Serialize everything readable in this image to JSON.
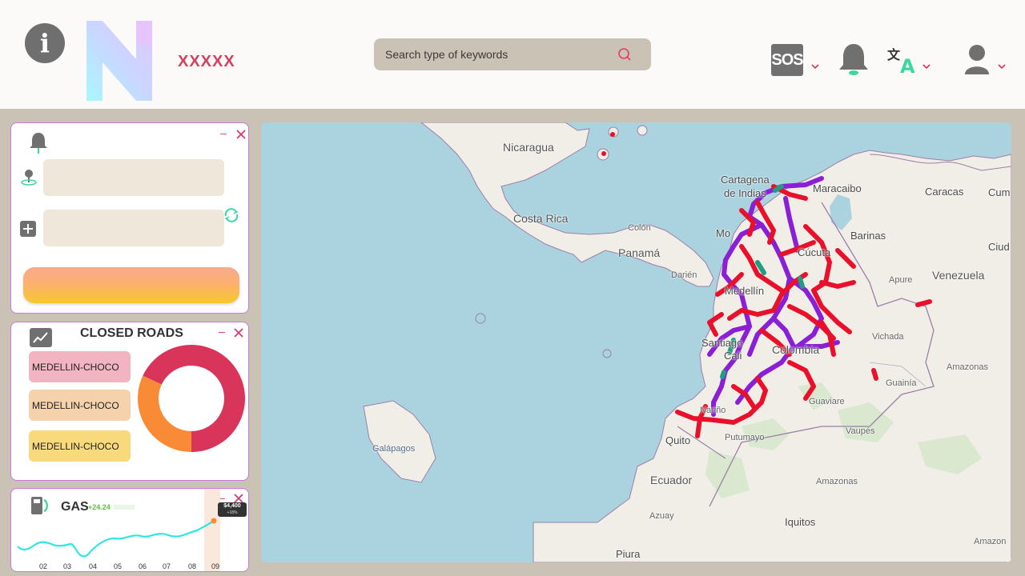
{
  "header": {
    "brand": "XXXXX",
    "search": {
      "placeholder": "Search type of keywords",
      "value": ""
    },
    "sos_label": "SOS",
    "info_label": "i"
  },
  "colors": {
    "accent": "#d6405f",
    "panel_border": "#c77ad8",
    "road_closed": "#e8102a",
    "road_purple": "#8a1fd6",
    "road_teal": "#1f9e82"
  },
  "closed_roads": {
    "title": "CLOSED ROADS",
    "items": [
      {
        "label": "MEDELLIN-CHOCO",
        "color": "#f2b4c0"
      },
      {
        "label": "MEDELLIN-CHOCO",
        "color": "#f5d2ac"
      },
      {
        "label": "MEDELLIN-CHOCO",
        "color": "#f8d97b"
      }
    ],
    "donut": [
      {
        "share": 0.68,
        "color": "#d9345a"
      },
      {
        "share": 0.32,
        "color": "#f98a36"
      }
    ]
  },
  "gas": {
    "title": "GAS",
    "change": "+24.24",
    "tooltip_value": "$4,400",
    "tooltip_change": "+18%",
    "months": [
      "02",
      "03",
      "04",
      "05",
      "06",
      "07",
      "08",
      "09"
    ]
  },
  "map": {
    "labels": {
      "nicaragua": "Nicaragua",
      "costa_rica": "Costa Rica",
      "colon": "Colón",
      "panama": "Panamá",
      "darien": "Darién",
      "cartagena": "Cartagena",
      "de_indias": "de Indias",
      "maracaibo": "Maracaibo",
      "caracas": "Caracas",
      "cum": "Cum",
      "barinas": "Barinas",
      "ciud": "Ciud",
      "apure": "Apure",
      "venezuela": "Venezuela",
      "cucuta": "Cúcuta",
      "medellin": "Medellín",
      "mo": "Mo",
      "santiago": "Santiago",
      "cali": "Cali",
      "colombia": "Colombia",
      "vichada": "Vichada",
      "amazonas_n": "Amazonas",
      "guainia": "Guainía",
      "guaviare": "Guaviare",
      "vaupes": "Vaupés",
      "putumayo": "Putumayo",
      "narino": "Nariño",
      "quito": "Quito",
      "ecuador": "Ecuador",
      "azuay": "Azuay",
      "amazonas_s": "Amazonas",
      "iquitos": "Iquitos",
      "galapagos": "Galápagos",
      "piura": "Piura",
      "amazon": "Amazon"
    }
  }
}
